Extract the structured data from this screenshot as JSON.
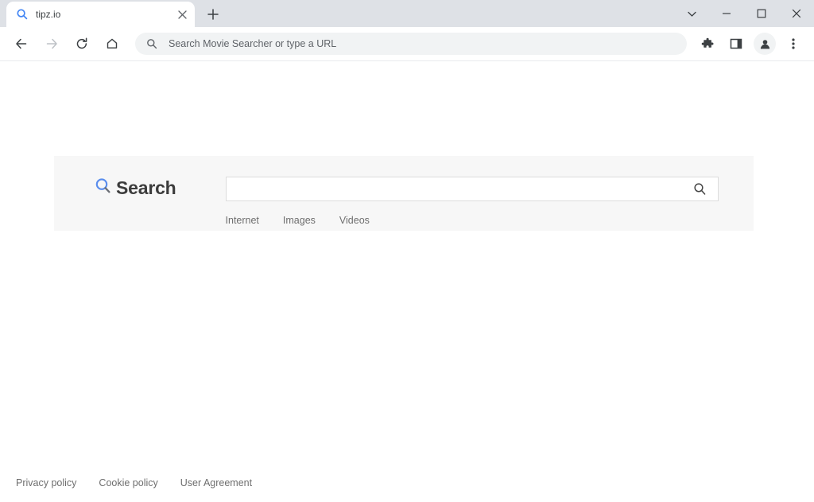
{
  "browser": {
    "tab": {
      "favicon": "search-icon",
      "title": "tipz.io",
      "close_label": "✕"
    },
    "new_tab_label": "+",
    "window_controls": {
      "tab_search": "chevron-down-icon",
      "minimize": "minimize-icon",
      "maximize": "maximize-icon",
      "close": "close-icon"
    },
    "nav": {
      "back": "back-arrow-icon",
      "forward": "forward-arrow-icon",
      "reload": "reload-icon",
      "home": "home-icon"
    },
    "omnibox": {
      "icon": "search-icon",
      "value": "",
      "placeholder": "Search Movie Searcher or type a URL"
    },
    "toolbar_right": {
      "extensions": "puzzle-piece-icon",
      "side_panel": "side-panel-icon",
      "profile": "avatar-icon",
      "menu": "three-dot-menu-icon"
    }
  },
  "page": {
    "logo": {
      "icon": "magnifier-icon",
      "text": "Search",
      "icon_color": "#4285f4",
      "text_color": "#3c3c3c"
    },
    "search": {
      "value": "",
      "placeholder": "",
      "submit_icon": "magnifier-icon"
    },
    "modes": [
      {
        "label": "Internet"
      },
      {
        "label": "Images"
      },
      {
        "label": "Videos"
      }
    ],
    "footer": [
      {
        "label": "Privacy policy"
      },
      {
        "label": "Cookie policy"
      },
      {
        "label": "User Agreement"
      }
    ],
    "panel_background": "#f7f7f7"
  }
}
